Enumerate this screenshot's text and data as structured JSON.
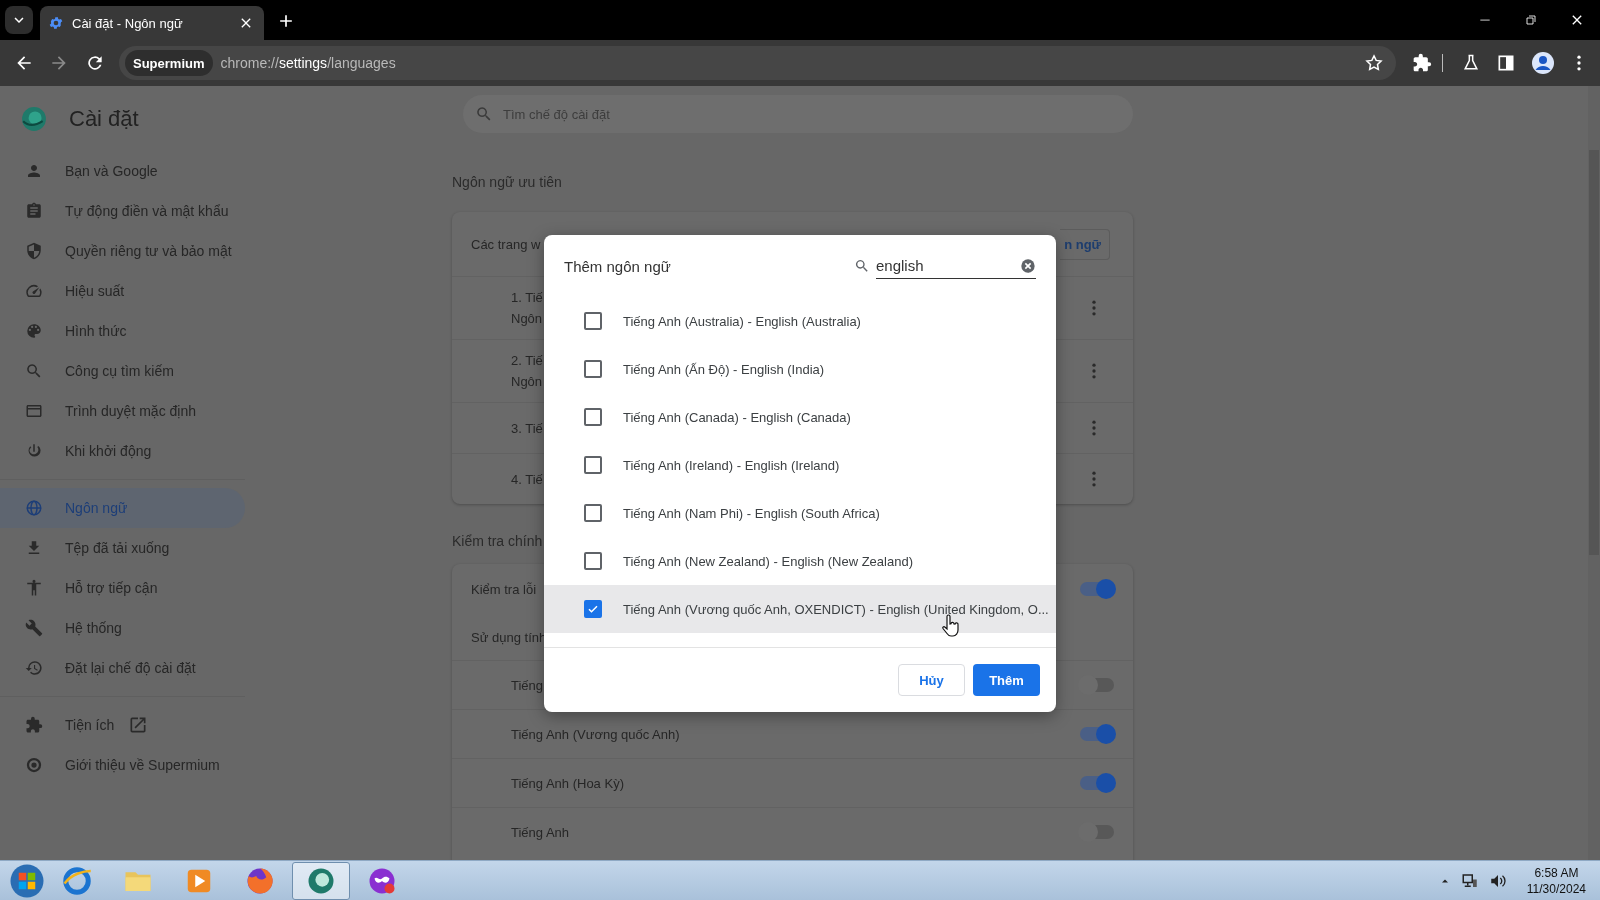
{
  "browser": {
    "tab_title": "Cài đặt - Ngôn ngữ",
    "site_chip": "Supermium",
    "url": {
      "scheme": "chrome://",
      "host": "settings",
      "path": "/languages"
    }
  },
  "settings_header": {
    "title": "Cài đặt",
    "search_placeholder": "Tìm chế độ cài đặt"
  },
  "sidebar": {
    "groups": [
      {
        "items": [
          {
            "label": "Bạn và Google",
            "selected": false,
            "external": false
          },
          {
            "label": "Tự động điền và mật khẩu",
            "selected": false,
            "external": false
          },
          {
            "label": "Quyền riêng tư và bảo mật",
            "selected": false,
            "external": false
          },
          {
            "label": "Hiệu suất",
            "selected": false,
            "external": false
          },
          {
            "label": "Hình thức",
            "selected": false,
            "external": false
          },
          {
            "label": "Công cụ tìm kiếm",
            "selected": false,
            "external": false
          },
          {
            "label": "Trình duyệt mặc định",
            "selected": false,
            "external": false
          },
          {
            "label": "Khi khởi động",
            "selected": false,
            "external": false
          }
        ]
      },
      {
        "items": [
          {
            "label": "Ngôn ngữ",
            "selected": true,
            "external": false
          },
          {
            "label": "Tệp đã tải xuống",
            "selected": false,
            "external": false
          },
          {
            "label": "Hỗ trợ tiếp cận",
            "selected": false,
            "external": false
          },
          {
            "label": "Hệ thống",
            "selected": false,
            "external": false
          },
          {
            "label": "Đặt lại chế độ cài đặt",
            "selected": false,
            "external": false
          }
        ]
      },
      {
        "items": [
          {
            "label": "Tiện ích",
            "selected": false,
            "external": true
          },
          {
            "label": "Giới thiệu về Supermium",
            "selected": false,
            "external": false
          }
        ]
      }
    ]
  },
  "preferred_languages": {
    "heading": "Ngôn ngữ ưu tiên",
    "intro": "Các trang w",
    "add_button": "n ngữ",
    "languages": [
      {
        "name": "1. Tiế",
        "detail": "Ngôn"
      },
      {
        "name": "2. Tiế",
        "detail": "Ngôn"
      },
      {
        "name": "3. Tiế"
      },
      {
        "name": "4. Tiế"
      }
    ]
  },
  "spell_check": {
    "heading": "Kiểm tra chính",
    "check_label": "Kiểm tra lỗi",
    "check_on": true,
    "use_label": "Sử dụng tính",
    "languages": [
      {
        "label": "Tiếng",
        "on": false
      },
      {
        "label": "Tiếng Anh (Vương quốc Anh)",
        "on": true
      },
      {
        "label": "Tiếng Anh (Hoa Kỳ)",
        "on": true
      },
      {
        "label": "Tiếng Anh",
        "on": false
      }
    ]
  },
  "dialog": {
    "title": "Thêm ngôn ngữ",
    "search_value": "english",
    "options": [
      {
        "label": "Tiếng Anh (Australia) - English (Australia)",
        "checked": false,
        "hovered": false
      },
      {
        "label": "Tiếng Anh (Ấn Độ) - English (India)",
        "checked": false,
        "hovered": false
      },
      {
        "label": "Tiếng Anh (Canada) - English (Canada)",
        "checked": false,
        "hovered": false
      },
      {
        "label": "Tiếng Anh (Ireland) - English (Ireland)",
        "checked": false,
        "hovered": false
      },
      {
        "label": "Tiếng Anh (Nam Phi) - English (South Africa)",
        "checked": false,
        "hovered": false
      },
      {
        "label": "Tiếng Anh (New Zealand) - English (New Zealand)",
        "checked": false,
        "hovered": false
      },
      {
        "label": "Tiếng Anh (Vương quốc Anh, OXENDICT) - English (United Kingdom, O...",
        "checked": true,
        "hovered": true
      }
    ],
    "buttons": [
      {
        "label": "Hủy",
        "kind": "secondary"
      },
      {
        "label": "Thêm",
        "kind": "primary"
      }
    ]
  },
  "taskbar": {
    "apps": [
      {
        "selected": false
      },
      {
        "selected": false
      },
      {
        "selected": false
      },
      {
        "selected": false
      },
      {
        "selected": true
      },
      {
        "selected": false
      }
    ],
    "time": "6:58 AM",
    "date": "11/30/2024"
  }
}
